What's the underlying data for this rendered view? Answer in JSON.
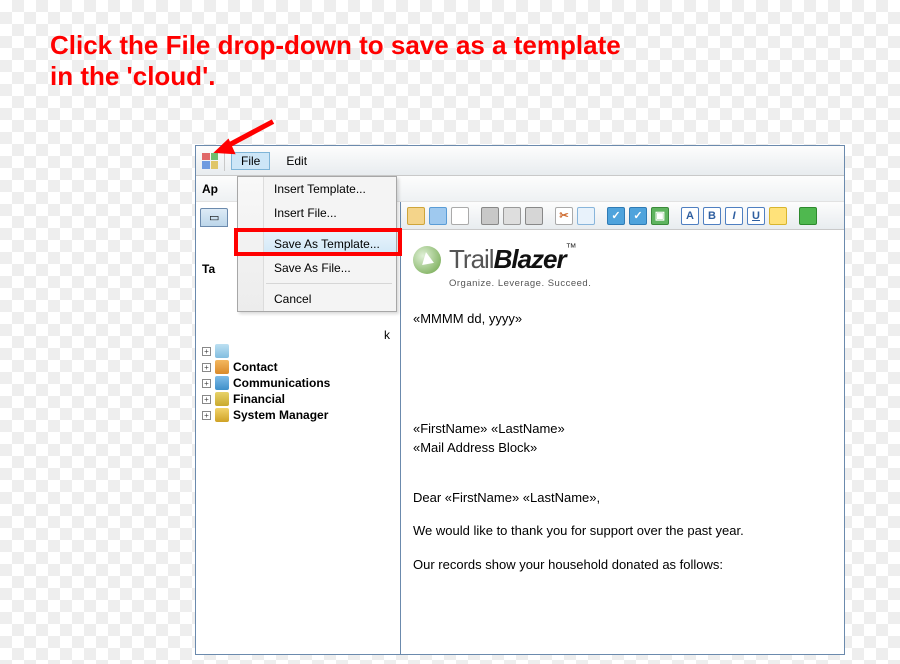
{
  "annotation": {
    "line1": "Click the File drop-down to save as a template",
    "line2": "in the 'cloud'."
  },
  "menubar": {
    "file": "File",
    "edit": "Edit"
  },
  "secondbar": {
    "prefix": "Ap"
  },
  "tabbar": {
    "first_cut": "Ta"
  },
  "dropdown": {
    "insert_template": "Insert Template...",
    "insert_file": "Insert File...",
    "save_as_template": "Save As Template...",
    "save_as_file": "Save As File...",
    "cancel": "Cancel"
  },
  "tree": {
    "attr_cut": "k",
    "contact": "Contact",
    "communications": "Communications",
    "financial": "Financial",
    "system_manager": "System Manager"
  },
  "brand": {
    "light": "Trail",
    "heavy": "Blazer",
    "tm": "™",
    "tag": "Organize. Leverage. Succeed."
  },
  "doc": {
    "date_field": "«MMMM dd, yyyy»",
    "name_line": "«FirstName» «LastName»",
    "addr_block": "«Mail Address Block»",
    "greeting": "Dear «FirstName» «LastName»,",
    "body1": "We would like to thank you for support over the past year.",
    "body2": "Our records show your household donated as follows:"
  },
  "icons": {
    "cut": "✂",
    "check": "✓",
    "img": "▣",
    "A": "A",
    "B": "B",
    "I": "I",
    "U": "U"
  }
}
